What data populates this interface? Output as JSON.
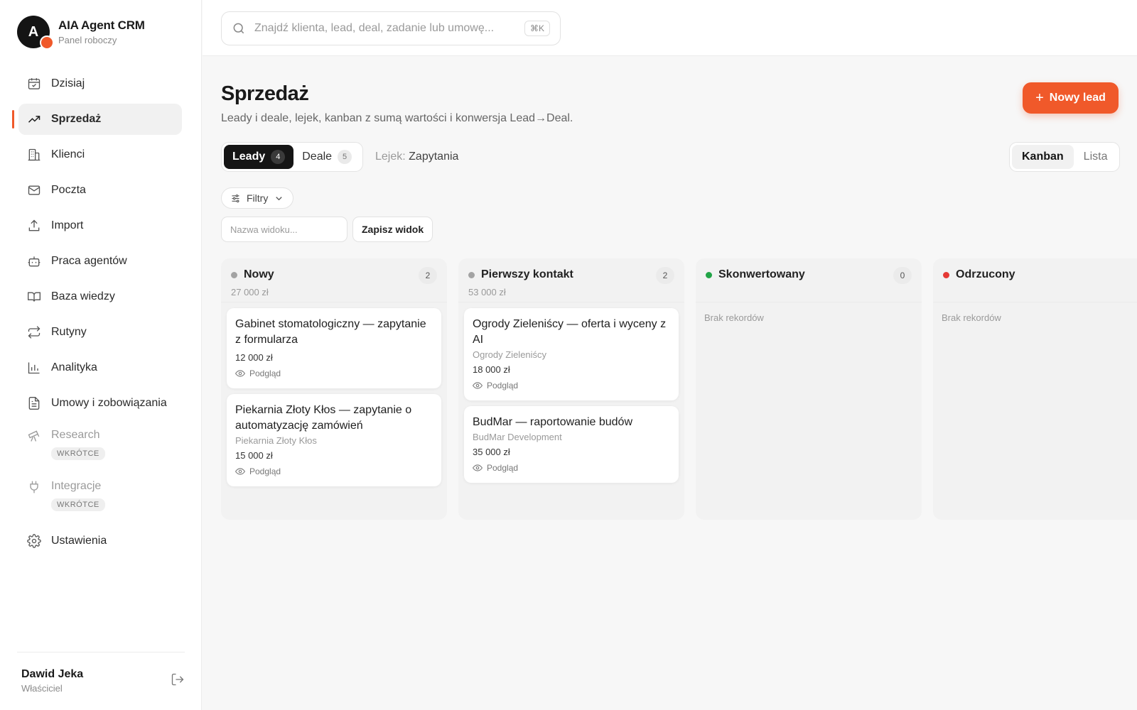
{
  "brand": {
    "initial": "A",
    "name": "AIA Agent CRM",
    "subtitle": "Panel roboczy"
  },
  "sidebar": {
    "items": [
      {
        "label": "Dzisiaj",
        "icon": "calendar-icon"
      },
      {
        "label": "Sprzedaż",
        "icon": "trending-up-icon",
        "active": true
      },
      {
        "label": "Klienci",
        "icon": "building-icon"
      },
      {
        "label": "Poczta",
        "icon": "mail-icon"
      },
      {
        "label": "Import",
        "icon": "upload-icon"
      },
      {
        "label": "Praca agentów",
        "icon": "bot-icon"
      },
      {
        "label": "Baza wiedzy",
        "icon": "book-icon"
      },
      {
        "label": "Rutyny",
        "icon": "repeat-icon"
      },
      {
        "label": "Analityka",
        "icon": "bar-chart-icon"
      },
      {
        "label": "Umowy i zobowiązania",
        "icon": "document-icon"
      },
      {
        "label": "Research",
        "icon": "telescope-icon",
        "badge": "WKRÓTCE"
      },
      {
        "label": "Integracje",
        "icon": "plug-icon",
        "badge": "WKRÓTCE"
      },
      {
        "label": "Ustawienia",
        "icon": "gear-icon"
      }
    ]
  },
  "user": {
    "name": "Dawid Jeka",
    "role": "Właściciel"
  },
  "search": {
    "placeholder": "Znajdź klienta, lead, deal, zadanie lub umowę...",
    "shortcut": "⌘K"
  },
  "header": {
    "title": "Sprzedaż",
    "subtitle": "Leady i deale, lejek, kanban z sumą wartości i konwersja Lead→Deal.",
    "new_button": "Nowy lead"
  },
  "tabs": [
    {
      "label": "Leady",
      "count": "4",
      "active": true
    },
    {
      "label": "Deale",
      "count": "5"
    }
  ],
  "funnel": {
    "label": "Lejek:",
    "value": "Zapytania"
  },
  "view_toggle": {
    "kanban": "Kanban",
    "list": "Lista"
  },
  "filters": {
    "label": "Filtry"
  },
  "view_name": {
    "placeholder": "Nazwa widoku...",
    "save_label": "Zapisz widok"
  },
  "board": {
    "columns": [
      {
        "title": "Nowy",
        "count": "2",
        "sum": "27 000 zł",
        "dot_color": "#a3a3a3",
        "cards": [
          {
            "title": "Gabinet stomatologiczny — zapytanie z formularza",
            "company": "",
            "value": "12 000 zł",
            "preview": "Podgląd"
          },
          {
            "title": "Piekarnia Złoty Kłos — zapytanie o automatyzację zamówień",
            "company": "Piekarnia Złoty Kłos",
            "value": "15 000 zł",
            "preview": "Podgląd"
          }
        ]
      },
      {
        "title": "Pierwszy kontakt",
        "count": "2",
        "sum": "53 000 zł",
        "dot_color": "#a3a3a3",
        "cards": [
          {
            "title": "Ogrody Zieleniścy — oferta i wyceny z AI",
            "company": "Ogrody Zieleniścy",
            "value": "18 000 zł",
            "preview": "Podgląd"
          },
          {
            "title": "BudMar — raportowanie budów",
            "company": "BudMar Development",
            "value": "35 000 zł",
            "preview": "Podgląd"
          }
        ]
      },
      {
        "title": "Skonwertowany",
        "count": "0",
        "sum": "",
        "dot_color": "#22a447",
        "empty": "Brak rekordów",
        "cards": []
      },
      {
        "title": "Odrzucony",
        "count": "",
        "sum": "",
        "dot_color": "#e53935",
        "empty": "Brak rekordów",
        "cards": []
      }
    ]
  },
  "colors": {
    "accent": "#f0592a",
    "dark": "#151515"
  }
}
